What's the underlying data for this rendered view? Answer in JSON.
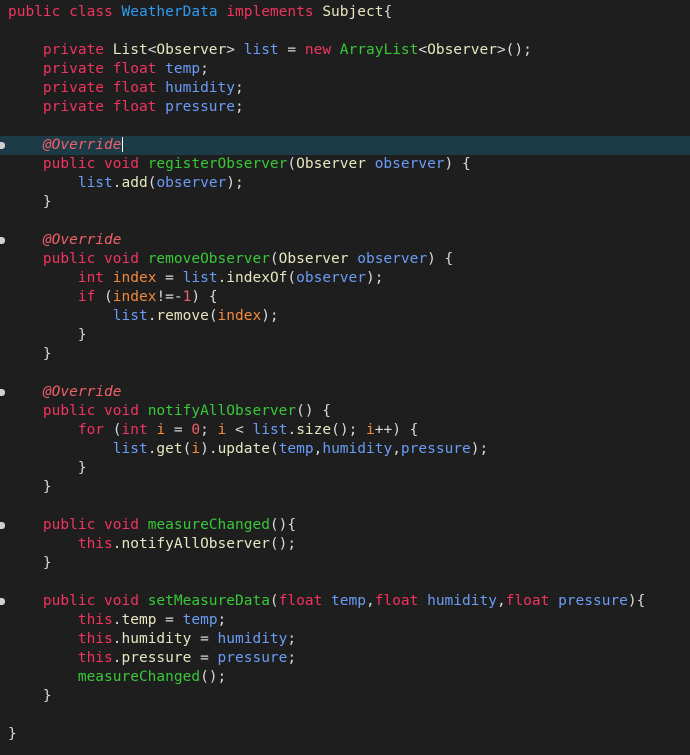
{
  "editor": {
    "lines": [
      {
        "marker": false,
        "current": false,
        "tokens": [
          [
            "kw",
            "public"
          ],
          [
            "plain",
            " "
          ],
          [
            "kw",
            "class"
          ],
          [
            "plain",
            " "
          ],
          [
            "cls",
            "WeatherData"
          ],
          [
            "plain",
            " "
          ],
          [
            "kw",
            "implements"
          ],
          [
            "plain",
            " "
          ],
          [
            "type",
            "Subject"
          ],
          [
            "plain",
            "{"
          ]
        ]
      },
      {
        "marker": false,
        "current": false,
        "tokens": []
      },
      {
        "marker": false,
        "current": false,
        "tokens": [
          [
            "plain",
            "    "
          ],
          [
            "kw",
            "private"
          ],
          [
            "plain",
            " "
          ],
          [
            "type",
            "List"
          ],
          [
            "plain",
            "<"
          ],
          [
            "type",
            "Observer"
          ],
          [
            "plain",
            "> "
          ],
          [
            "fld",
            "list"
          ],
          [
            "plain",
            " = "
          ],
          [
            "kw",
            "new"
          ],
          [
            "plain",
            " "
          ],
          [
            "mth",
            "ArrayList"
          ],
          [
            "plain",
            "<"
          ],
          [
            "type",
            "Observer"
          ],
          [
            "plain",
            ">();"
          ]
        ]
      },
      {
        "marker": false,
        "current": false,
        "tokens": [
          [
            "plain",
            "    "
          ],
          [
            "kw",
            "private"
          ],
          [
            "plain",
            " "
          ],
          [
            "kw",
            "float"
          ],
          [
            "plain",
            " "
          ],
          [
            "fld",
            "temp"
          ],
          [
            "plain",
            ";"
          ]
        ]
      },
      {
        "marker": false,
        "current": false,
        "tokens": [
          [
            "plain",
            "    "
          ],
          [
            "kw",
            "private"
          ],
          [
            "plain",
            " "
          ],
          [
            "kw",
            "float"
          ],
          [
            "plain",
            " "
          ],
          [
            "fld",
            "humidity"
          ],
          [
            "plain",
            ";"
          ]
        ]
      },
      {
        "marker": false,
        "current": false,
        "tokens": [
          [
            "plain",
            "    "
          ],
          [
            "kw",
            "private"
          ],
          [
            "plain",
            " "
          ],
          [
            "kw",
            "float"
          ],
          [
            "plain",
            " "
          ],
          [
            "fld",
            "pressure"
          ],
          [
            "plain",
            ";"
          ]
        ]
      },
      {
        "marker": false,
        "current": false,
        "tokens": []
      },
      {
        "marker": true,
        "current": true,
        "caret": true,
        "tokens": [
          [
            "plain",
            "    "
          ],
          [
            "ann",
            "@Override"
          ]
        ]
      },
      {
        "marker": false,
        "current": false,
        "tokens": [
          [
            "plain",
            "    "
          ],
          [
            "kw",
            "public"
          ],
          [
            "plain",
            " "
          ],
          [
            "kw",
            "void"
          ],
          [
            "plain",
            " "
          ],
          [
            "mth",
            "registerObserver"
          ],
          [
            "plain",
            "("
          ],
          [
            "type",
            "Observer"
          ],
          [
            "plain",
            " "
          ],
          [
            "fld",
            "observer"
          ],
          [
            "plain",
            ") {"
          ]
        ]
      },
      {
        "marker": false,
        "current": false,
        "tokens": [
          [
            "plain",
            "        "
          ],
          [
            "fld",
            "list"
          ],
          [
            "plain",
            "."
          ],
          [
            "type",
            "add"
          ],
          [
            "plain",
            "("
          ],
          [
            "fld",
            "observer"
          ],
          [
            "plain",
            ");"
          ]
        ]
      },
      {
        "marker": false,
        "current": false,
        "tokens": [
          [
            "plain",
            "    }"
          ]
        ]
      },
      {
        "marker": false,
        "current": false,
        "tokens": []
      },
      {
        "marker": true,
        "current": false,
        "tokens": [
          [
            "plain",
            "    "
          ],
          [
            "ann",
            "@Override"
          ]
        ]
      },
      {
        "marker": false,
        "current": false,
        "tokens": [
          [
            "plain",
            "    "
          ],
          [
            "kw",
            "public"
          ],
          [
            "plain",
            " "
          ],
          [
            "kw",
            "void"
          ],
          [
            "plain",
            " "
          ],
          [
            "mth",
            "removeObserver"
          ],
          [
            "plain",
            "("
          ],
          [
            "type",
            "Observer"
          ],
          [
            "plain",
            " "
          ],
          [
            "fld",
            "observer"
          ],
          [
            "plain",
            ") {"
          ]
        ]
      },
      {
        "marker": false,
        "current": false,
        "tokens": [
          [
            "plain",
            "        "
          ],
          [
            "kw",
            "int"
          ],
          [
            "plain",
            " "
          ],
          [
            "var",
            "index"
          ],
          [
            "plain",
            " = "
          ],
          [
            "fld",
            "list"
          ],
          [
            "plain",
            "."
          ],
          [
            "type",
            "indexOf"
          ],
          [
            "plain",
            "("
          ],
          [
            "fld",
            "observer"
          ],
          [
            "plain",
            ");"
          ]
        ]
      },
      {
        "marker": false,
        "current": false,
        "tokens": [
          [
            "plain",
            "        "
          ],
          [
            "kw",
            "if"
          ],
          [
            "plain",
            " ("
          ],
          [
            "var",
            "index"
          ],
          [
            "plain",
            "!=-"
          ],
          [
            "num",
            "1"
          ],
          [
            "plain",
            ") {"
          ]
        ]
      },
      {
        "marker": false,
        "current": false,
        "tokens": [
          [
            "plain",
            "            "
          ],
          [
            "fld",
            "list"
          ],
          [
            "plain",
            "."
          ],
          [
            "type",
            "remove"
          ],
          [
            "plain",
            "("
          ],
          [
            "var",
            "index"
          ],
          [
            "plain",
            ");"
          ]
        ]
      },
      {
        "marker": false,
        "current": false,
        "tokens": [
          [
            "plain",
            "        }"
          ]
        ]
      },
      {
        "marker": false,
        "current": false,
        "tokens": [
          [
            "plain",
            "    }"
          ]
        ]
      },
      {
        "marker": false,
        "current": false,
        "tokens": []
      },
      {
        "marker": true,
        "current": false,
        "tokens": [
          [
            "plain",
            "    "
          ],
          [
            "ann",
            "@Override"
          ]
        ]
      },
      {
        "marker": false,
        "current": false,
        "tokens": [
          [
            "plain",
            "    "
          ],
          [
            "kw",
            "public"
          ],
          [
            "plain",
            " "
          ],
          [
            "kw",
            "void"
          ],
          [
            "plain",
            " "
          ],
          [
            "mth",
            "notifyAllObserver"
          ],
          [
            "plain",
            "() {"
          ]
        ]
      },
      {
        "marker": false,
        "current": false,
        "tokens": [
          [
            "plain",
            "        "
          ],
          [
            "kw",
            "for"
          ],
          [
            "plain",
            " ("
          ],
          [
            "kw",
            "int"
          ],
          [
            "plain",
            " "
          ],
          [
            "var",
            "i"
          ],
          [
            "plain",
            " = "
          ],
          [
            "num",
            "0"
          ],
          [
            "plain",
            "; "
          ],
          [
            "var",
            "i"
          ],
          [
            "plain",
            " < "
          ],
          [
            "fld",
            "list"
          ],
          [
            "plain",
            "."
          ],
          [
            "type",
            "size"
          ],
          [
            "plain",
            "(); "
          ],
          [
            "var",
            "i"
          ],
          [
            "plain",
            "++) {"
          ]
        ]
      },
      {
        "marker": false,
        "current": false,
        "tokens": [
          [
            "plain",
            "            "
          ],
          [
            "fld",
            "list"
          ],
          [
            "plain",
            "."
          ],
          [
            "type",
            "get"
          ],
          [
            "plain",
            "("
          ],
          [
            "var",
            "i"
          ],
          [
            "plain",
            ")."
          ],
          [
            "type",
            "update"
          ],
          [
            "plain",
            "("
          ],
          [
            "fld",
            "temp"
          ],
          [
            "plain",
            ","
          ],
          [
            "fld",
            "humidity"
          ],
          [
            "plain",
            ","
          ],
          [
            "fld",
            "pressure"
          ],
          [
            "plain",
            ");"
          ]
        ]
      },
      {
        "marker": false,
        "current": false,
        "tokens": [
          [
            "plain",
            "        }"
          ]
        ]
      },
      {
        "marker": false,
        "current": false,
        "tokens": [
          [
            "plain",
            "    }"
          ]
        ]
      },
      {
        "marker": false,
        "current": false,
        "tokens": []
      },
      {
        "marker": true,
        "current": false,
        "tokens": [
          [
            "plain",
            "    "
          ],
          [
            "kw",
            "public"
          ],
          [
            "plain",
            " "
          ],
          [
            "kw",
            "void"
          ],
          [
            "plain",
            " "
          ],
          [
            "mth",
            "measureChanged"
          ],
          [
            "plain",
            "(){"
          ]
        ]
      },
      {
        "marker": false,
        "current": false,
        "tokens": [
          [
            "plain",
            "        "
          ],
          [
            "kw",
            "this"
          ],
          [
            "plain",
            "."
          ],
          [
            "type",
            "notifyAllObserver"
          ],
          [
            "plain",
            "();"
          ]
        ]
      },
      {
        "marker": false,
        "current": false,
        "tokens": [
          [
            "plain",
            "    }"
          ]
        ]
      },
      {
        "marker": false,
        "current": false,
        "tokens": []
      },
      {
        "marker": true,
        "current": false,
        "tokens": [
          [
            "plain",
            "    "
          ],
          [
            "kw",
            "public"
          ],
          [
            "plain",
            " "
          ],
          [
            "kw",
            "void"
          ],
          [
            "plain",
            " "
          ],
          [
            "mth",
            "setMeasureData"
          ],
          [
            "plain",
            "("
          ],
          [
            "kw",
            "float"
          ],
          [
            "plain",
            " "
          ],
          [
            "fld",
            "temp"
          ],
          [
            "plain",
            ","
          ],
          [
            "kw",
            "float"
          ],
          [
            "plain",
            " "
          ],
          [
            "fld",
            "humidity"
          ],
          [
            "plain",
            ","
          ],
          [
            "kw",
            "float"
          ],
          [
            "plain",
            " "
          ],
          [
            "fld",
            "pressure"
          ],
          [
            "plain",
            "){"
          ]
        ]
      },
      {
        "marker": false,
        "current": false,
        "tokens": [
          [
            "plain",
            "        "
          ],
          [
            "kw",
            "this"
          ],
          [
            "plain",
            "."
          ],
          [
            "type",
            "temp"
          ],
          [
            "plain",
            " = "
          ],
          [
            "fld",
            "temp"
          ],
          [
            "plain",
            ";"
          ]
        ]
      },
      {
        "marker": false,
        "current": false,
        "tokens": [
          [
            "plain",
            "        "
          ],
          [
            "kw",
            "this"
          ],
          [
            "plain",
            "."
          ],
          [
            "type",
            "humidity"
          ],
          [
            "plain",
            " = "
          ],
          [
            "fld",
            "humidity"
          ],
          [
            "plain",
            ";"
          ]
        ]
      },
      {
        "marker": false,
        "current": false,
        "tokens": [
          [
            "plain",
            "        "
          ],
          [
            "kw",
            "this"
          ],
          [
            "plain",
            "."
          ],
          [
            "type",
            "pressure"
          ],
          [
            "plain",
            " = "
          ],
          [
            "fld",
            "pressure"
          ],
          [
            "plain",
            ";"
          ]
        ]
      },
      {
        "marker": false,
        "current": false,
        "tokens": [
          [
            "plain",
            "        "
          ],
          [
            "mth",
            "measureChanged"
          ],
          [
            "plain",
            "();"
          ]
        ]
      },
      {
        "marker": false,
        "current": false,
        "tokens": [
          [
            "plain",
            "    }"
          ]
        ]
      },
      {
        "marker": false,
        "current": false,
        "tokens": []
      },
      {
        "marker": false,
        "current": false,
        "tokens": [
          [
            "plain",
            "}"
          ]
        ]
      }
    ]
  }
}
